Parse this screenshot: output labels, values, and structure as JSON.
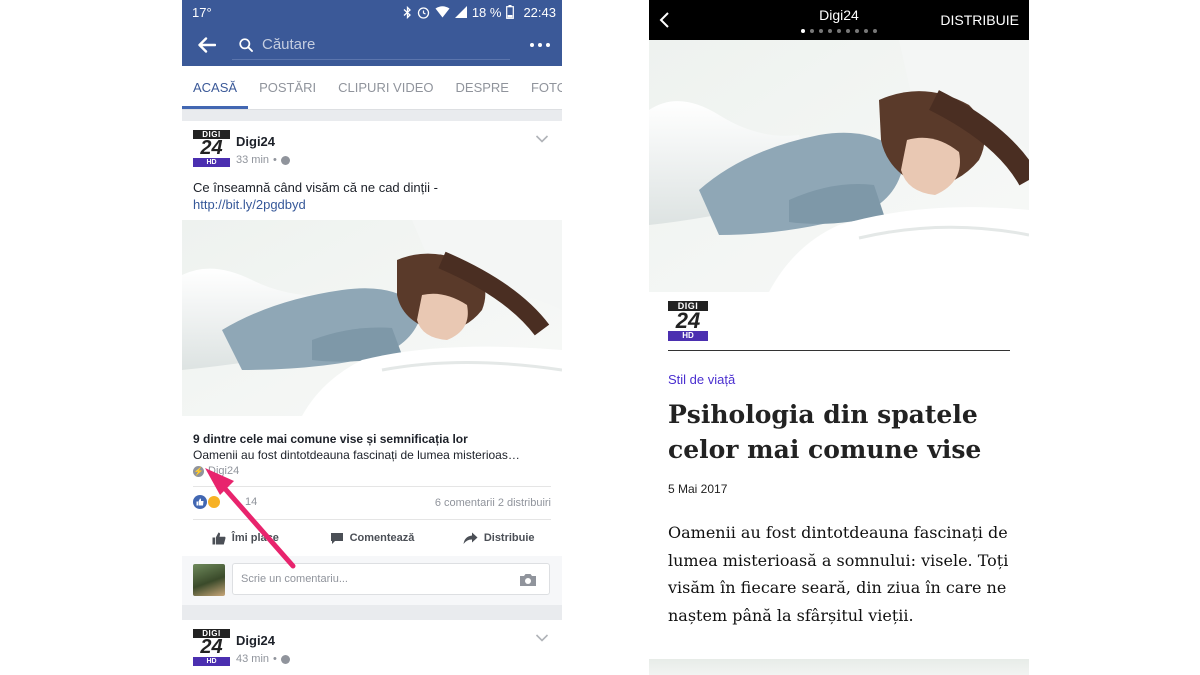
{
  "left_screen": {
    "status_bar": {
      "temperature": "17°",
      "battery": "18 %",
      "time": "22:43"
    },
    "header": {
      "search_placeholder": "Căutare"
    },
    "tabs": [
      {
        "label": "ACASĂ",
        "active": true
      },
      {
        "label": "POSTĂRI",
        "active": false
      },
      {
        "label": "CLIPURI VIDEO",
        "active": false
      },
      {
        "label": "DESPRE",
        "active": false
      },
      {
        "label": "FOTOGR",
        "active": false
      }
    ],
    "post": {
      "page_name": "Digi24",
      "time": "33 min",
      "text": "Ce înseamnă când visăm că ne cad dinții -",
      "link_url": "http://bit.ly/2pgdbyd",
      "link_title": "9 dintre cele mai comune vise și semnificația lor",
      "link_description": "Oamenii au fost dintotdeauna fascinați de lumea misterioas…",
      "link_source": "Digi24",
      "reactions_count": "14",
      "comments_shares": "6 comentarii  2 distribuiri",
      "actions": {
        "like": "Îmi place",
        "comment": "Comentează",
        "share": "Distribuie"
      },
      "comment_placeholder": "Scrie un comentariu..."
    },
    "post2": {
      "page_name": "Digi24",
      "time": "43 min"
    },
    "logo": {
      "top": "DIGI",
      "middle": "24",
      "bottom": "HD"
    }
  },
  "right_screen": {
    "top_bar": {
      "title": "Digi24",
      "share_label": "DISTRIBUIE",
      "page_dots": 9,
      "active_dot": 1
    },
    "logo": {
      "top": "DIGI",
      "middle": "24",
      "bottom": "HD"
    },
    "article": {
      "category": "Stil de viață",
      "headline": "Psihologia din spatele celor mai comune vise",
      "date": "5 Mai 2017",
      "lead": "Oamenii au fost dintotdeauna fascinați de lumea misterioasă a somnului: visele. Toți visăm în fiecare seară, din ziua în care ne naștem până la sfârșitul vieții."
    }
  },
  "colors": {
    "facebook_blue": "#3b5998",
    "highlight_arrow": "#e8246d",
    "kicker_purple": "#4a2fd0"
  }
}
